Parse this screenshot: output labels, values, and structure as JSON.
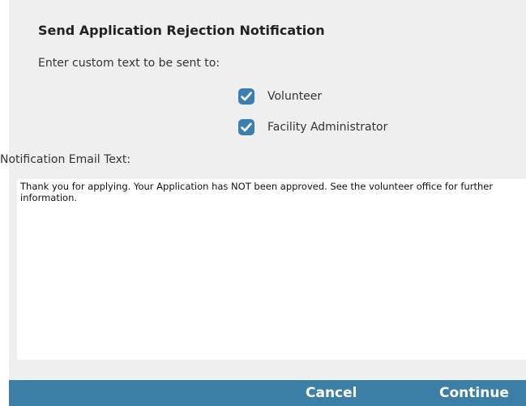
{
  "dialog": {
    "title": "Send Application Rejection Notification",
    "subtitle": "Enter custom text to be sent to:",
    "recipients": [
      {
        "label": "Volunteer",
        "checked": true
      },
      {
        "label": "Facility Administrator",
        "checked": true
      }
    ],
    "email_text_label": "Notification Email Text:",
    "email_text_value": "Thank you for applying. Your Application has NOT been approved. See the volunteer office for further information."
  },
  "footer": {
    "cancel_label": "Cancel",
    "continue_label": "Continue"
  },
  "colors": {
    "accent": "#3b7fa6",
    "checkbox": "#3b7fb2",
    "panel_background": "#efefef"
  },
  "icons": {
    "checkbox": "checkmark-icon"
  }
}
